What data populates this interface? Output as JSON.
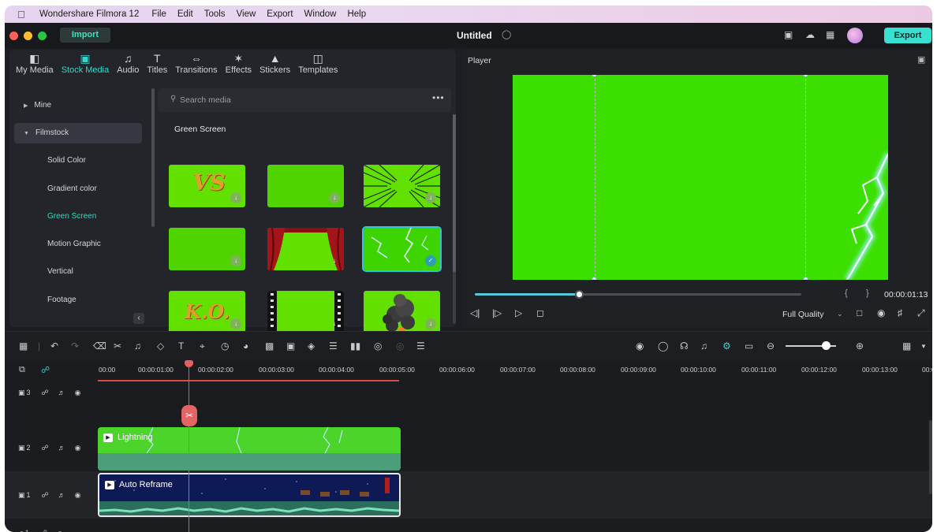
{
  "menubar": {
    "app_name": "Wondershare Filmora 12",
    "items": [
      "File",
      "Edit",
      "Tools",
      "View",
      "Export",
      "Window",
      "Help"
    ]
  },
  "titlebar": {
    "import_label": "Import",
    "doc_title": "Untitled",
    "export_label": "Export"
  },
  "library": {
    "tabs": [
      {
        "label": "My Media",
        "icon": "my-media-icon"
      },
      {
        "label": "Stock Media",
        "icon": "stock-media-icon"
      },
      {
        "label": "Audio",
        "icon": "audio-icon"
      },
      {
        "label": "Titles",
        "icon": "titles-icon"
      },
      {
        "label": "Transitions",
        "icon": "transitions-icon"
      },
      {
        "label": "Effects",
        "icon": "effects-icon"
      },
      {
        "label": "Stickers",
        "icon": "stickers-icon"
      },
      {
        "label": "Templates",
        "icon": "templates-icon"
      }
    ],
    "active_tab": "Stock Media",
    "sidebar": {
      "groups": [
        "Mine",
        "Filmstock"
      ],
      "sub_items": [
        "Solid Color",
        "Gradient color",
        "Green Screen",
        "Motion Graphic",
        "Vertical",
        "Footage"
      ],
      "selected": "Green Screen"
    },
    "search_placeholder": "Search media",
    "section_title": "Green Screen",
    "thumbs": [
      {
        "label": "VS"
      },
      {
        "label": ""
      },
      {
        "label": ""
      },
      {
        "label": ""
      },
      {
        "label": ""
      },
      {
        "label": ""
      },
      {
        "label": "K.O."
      },
      {
        "label": ""
      },
      {
        "label": ""
      }
    ],
    "selected_thumb_index": 5
  },
  "player": {
    "label": "Player",
    "timecode": "00:00:01:13",
    "quality": "Full Quality",
    "progress": 0.32
  },
  "timeline": {
    "ruler": [
      "00:00",
      "00:00:01:00",
      "00:00:02:00",
      "00:00:03:00",
      "00:00:04:00",
      "00:00:05:00",
      "00:00:06:00",
      "00:00:07:00",
      "00:00:08:00",
      "00:00:09:00",
      "00:00:10:00",
      "00:00:11:00",
      "00:00:12:00",
      "00:00:13:00",
      "00:0"
    ],
    "tracks": [
      {
        "num": "3",
        "type": "video"
      },
      {
        "num": "2",
        "type": "video"
      },
      {
        "num": "1",
        "type": "video"
      },
      {
        "num": "1",
        "type": "audio"
      }
    ],
    "clips": {
      "lightning": "Lightning",
      "reframe": "Auto Reframe"
    },
    "zoom_level": 0.8
  },
  "colors": {
    "accent": "#33d6cc",
    "green_screen": "#3ce000",
    "playhead": "#e05a5a"
  }
}
